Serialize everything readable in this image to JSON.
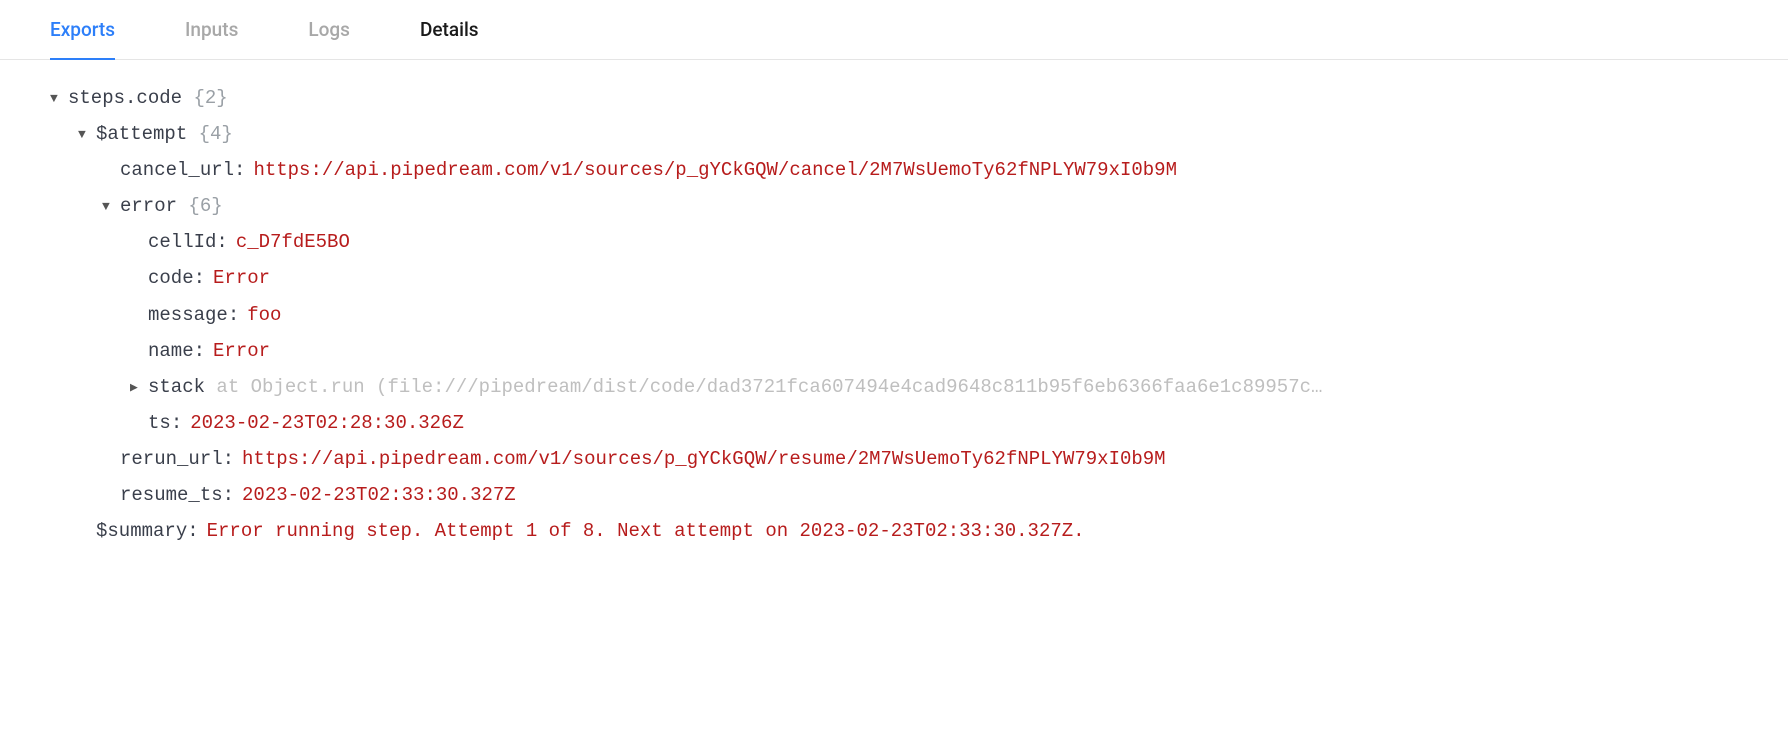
{
  "tabs": {
    "exports": "Exports",
    "inputs": "Inputs",
    "logs": "Logs",
    "details": "Details"
  },
  "tree": {
    "root_key": "steps.code",
    "root_count": "{2}",
    "attempt_key": "$attempt",
    "attempt_count": "{4}",
    "cancel_url_key": "cancel_url",
    "cancel_url_val": "https://api.pipedream.com/v1/sources/p_gYCkGQW/cancel/2M7WsUemoTy62fNPLYW79xI0b9M",
    "error_key": "error",
    "error_count": "{6}",
    "cellId_key": "cellId",
    "cellId_val": "c_D7fdE5BO",
    "code_key": "code",
    "code_val": "Error",
    "message_key": "message",
    "message_val": "foo",
    "name_key": "name",
    "name_val": "Error",
    "stack_key": "stack",
    "stack_preview": "at Object.run (file:///pipedream/dist/code/dad3721fca607494e4cad9648c811b95f6eb6366faa6e1c89957c",
    "ts_key": "ts",
    "ts_val": "2023-02-23T02:28:30.326Z",
    "rerun_url_key": "rerun_url",
    "rerun_url_val": "https://api.pipedream.com/v1/sources/p_gYCkGQW/resume/2M7WsUemoTy62fNPLYW79xI0b9M",
    "resume_ts_key": "resume_ts",
    "resume_ts_val": "2023-02-23T02:33:30.327Z",
    "summary_key": "$summary",
    "summary_val": "Error running step.  Attempt 1 of 8.  Next attempt on 2023-02-23T02:33:30.327Z."
  }
}
